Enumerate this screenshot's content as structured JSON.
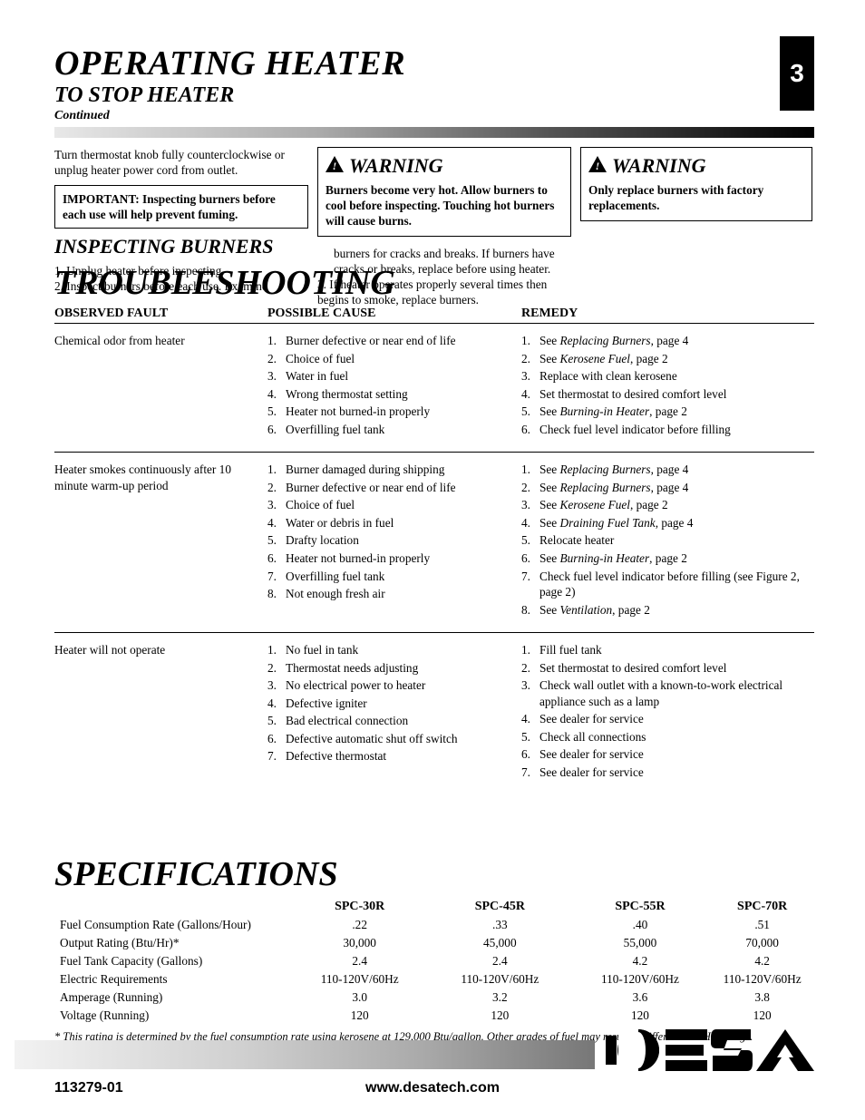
{
  "page_number_top": "3",
  "page_number_bottom": "113279-01",
  "website": "www.desatech.com",
  "section_heading": "OPERATING HEATER",
  "subheading_ts": "TO STOP HEATER",
  "content_line": "Continued",
  "stop_text": "Turn thermostat knob fully counterclockwise or unplug heater power cord from outlet.",
  "inspect_heading": "INSPECTING BURNERS",
  "important_label": "IMPORTANT:",
  "important_text": " Inspecting burners before each use will help prevent fuming.",
  "inspect_1": "1. Unplug heater before inspecting.",
  "inspect_2": "2. Inspect burners before each use. Examine",
  "warn1_head": "WARNING",
  "warn1_body": "Burners become very hot. Allow burners to cool before inspecting. Touching hot burners will cause burns.",
  "col2_line1": "burners for cracks and breaks. If burners have cracks or breaks, replace before using heater.",
  "col2_line2": "3. If heater operates properly several times then begins to smoke, replace burners.",
  "warn2_head": "WARNING",
  "warn2_body": "Only replace burners with factory replacements.",
  "ts_heading": "TROUBLESHOOTING",
  "ts_headers": [
    "OBSERVED FAULT",
    "POSSIBLE CAUSE",
    "REMEDY"
  ],
  "ts_rows": [
    {
      "obs": "Chemical odor from heater",
      "causes": [
        "Burner defective or near end of life",
        "Choice of fuel",
        "Water in fuel",
        "Wrong thermostat setting",
        "Heater not burned-in properly",
        "Overfilling fuel tank"
      ],
      "remedies": [
        "See <i>Replacing Burners</i>, page 4",
        "See <i>Kerosene Fuel</i>, page 2",
        "Replace with clean kerosene",
        "Set thermostat to desired comfort level",
        "See <i>Burning-in Heater</i>, page 2",
        "Check fuel level indicator before filling"
      ]
    },
    {
      "obs": "Heater smokes continuously after 10 minute warm-up period",
      "causes": [
        "Burner damaged during shipping",
        "Burner defective or near end of life",
        "Choice of fuel",
        "Water or debris in fuel",
        "Drafty location",
        "Heater not burned-in properly",
        "Overfilling fuel tank",
        "Not enough fresh air"
      ],
      "remedies": [
        "See <i>Replacing Burners</i>, page 4",
        "See <i>Replacing Burners</i>, page 4",
        "See <i>Kerosene Fuel</i>, page 2",
        "See <i>Draining Fuel Tank</i>, page 4",
        "Relocate heater",
        "See <i>Burning-in Heater</i>, page 2",
        "Check fuel level indicator before filling (see Figure 2, page 2)",
        "See <i>Ventilation</i>, page 2"
      ]
    },
    {
      "obs": "Heater will not operate",
      "causes": [
        "No fuel in tank",
        "Thermostat needs adjusting",
        "No electrical power to heater",
        "Defective igniter",
        "Bad electrical connection",
        "Defective automatic shut off switch",
        "Defective thermostat"
      ],
      "remedies": [
        "Fill fuel tank",
        "Set thermostat to desired comfort level",
        "Check wall outlet with a known-to-work electrical appliance such as a lamp",
        "See dealer for service",
        "Check all connections",
        "See dealer for service",
        "See dealer for service"
      ]
    }
  ],
  "spec_heading": "SPECIFICATIONS",
  "spec_headers": [
    "",
    "SPC-30R",
    "SPC-45R",
    "SPC-55R",
    "SPC-70R"
  ],
  "spec_rows": [
    [
      "Fuel Consumption Rate (Gallons/Hour)",
      ".22",
      ".33",
      ".40",
      ".51"
    ],
    [
      "Output Rating (Btu/Hr)*",
      "30,000",
      "45,000",
      "55,000",
      "70,000"
    ],
    [
      "Fuel Tank Capacity (Gallons)",
      "2.4",
      "2.4",
      "4.2",
      "4.2"
    ],
    [
      "Electric Requirements",
      "110-120V/60Hz",
      "110-120V/60Hz",
      "110-120V/60Hz",
      "110-120V/60Hz"
    ],
    [
      "Amperage (Running)",
      "3.0",
      "3.2",
      "3.6",
      "3.8"
    ],
    [
      "Voltage (Running)",
      "120",
      "120",
      "120",
      "120"
    ]
  ],
  "spec_note": "* This rating is determined by the fuel consumption rate using kerosene at 129,000 Btu/gallon. Other grades of fuel may result in different Btu/Hr ratings."
}
